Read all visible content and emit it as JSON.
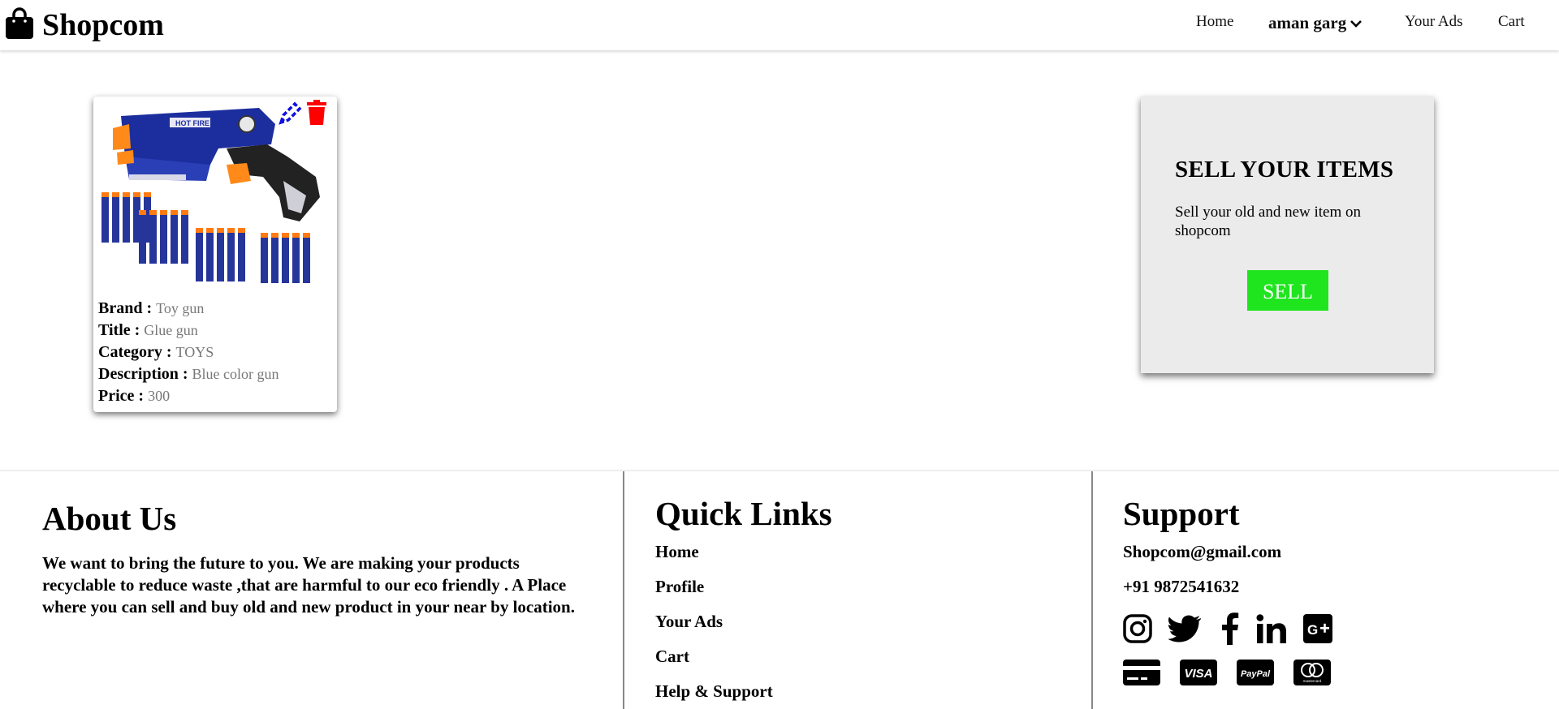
{
  "navbar": {
    "brand": "Shopcom",
    "brand_icon": "shopping-bag-icon",
    "home": "Home",
    "user": "aman garg",
    "your_ads": "Your Ads",
    "cart": "Cart"
  },
  "product": {
    "image_alt": "Toy gun with foam darts",
    "fields": [
      {
        "label": "Brand :",
        "value": "Toy gun"
      },
      {
        "label": "Title :",
        "value": "Glue gun"
      },
      {
        "label": "Category :",
        "value": "TOYS"
      },
      {
        "label": "Description :",
        "value": "Blue color gun"
      },
      {
        "label": "Price :",
        "value": "300"
      }
    ],
    "edit_icon": "pencil-icon",
    "delete_icon": "trash-icon"
  },
  "sell": {
    "title": "SELL YOUR ITEMS",
    "description": "Sell your old and new item on shopcom",
    "button": "SELL"
  },
  "footer": {
    "about_title": "About Us",
    "about_text": "We want to bring the future to you. We are making your products recyclable to reduce waste ,that are harmful to our eco friendly . A Place where you can sell and buy old and new product in your near by location.",
    "links_title": "Quick Links",
    "links": [
      "Home",
      "Profile",
      "Your Ads",
      "Cart",
      "Help & Support"
    ],
    "support_title": "Support",
    "email": "Shopcom@gmail.com",
    "phone": "+91 9872541632",
    "social_icons": [
      "instagram-icon",
      "twitter-icon",
      "facebook-icon",
      "linkedin-icon",
      "google-plus-icon"
    ],
    "payment_icons": [
      "credit-card-icon",
      "visa-icon",
      "paypal-icon",
      "mastercard-icon"
    ],
    "payment_labels": {
      "visa": "VISA",
      "paypal": "PayPal",
      "mastercard": "mastercard"
    }
  },
  "colors": {
    "sell_button": "#1fe51f",
    "sell_box_bg": "#ebebeb",
    "edit_icon": "#1010e0",
    "delete_icon": "#ff0000",
    "muted_value": "#777777"
  }
}
